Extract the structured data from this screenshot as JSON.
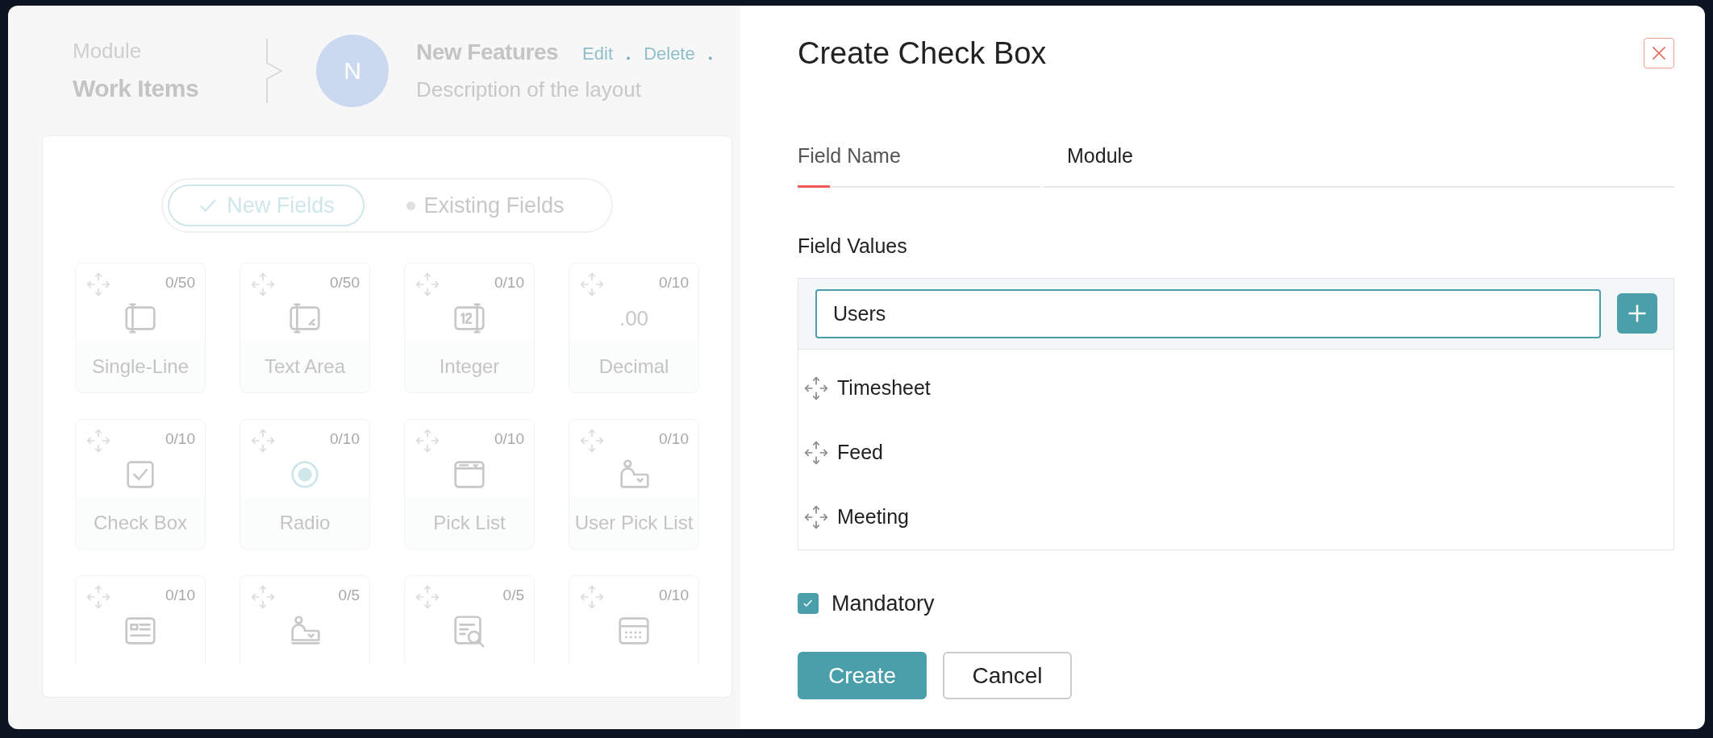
{
  "background_panel": {
    "breadcrumb": {
      "label": "Module",
      "value": "Work Items"
    },
    "layout": {
      "avatar": "N",
      "name": "New Features",
      "actions": [
        "Edit",
        "Delete"
      ],
      "separator": ".",
      "description": "Description of the layout"
    },
    "field_tabs": [
      {
        "label": "New Fields",
        "selected": true
      },
      {
        "label": "Existing Fields",
        "selected": false
      }
    ],
    "field_types": [
      {
        "kind": "single-line",
        "count": "0/50",
        "label": "Single-Line"
      },
      {
        "kind": "text-area",
        "count": "0/50",
        "label": "Text Area"
      },
      {
        "kind": "integer",
        "count": "0/10",
        "label": "Integer"
      },
      {
        "kind": "decimal",
        "count": "0/10",
        "label": "Decimal",
        "icon_text": ".00"
      },
      {
        "kind": "check-box",
        "count": "0/10",
        "label": "Check Box"
      },
      {
        "kind": "radio",
        "count": "0/10",
        "label": "Radio"
      },
      {
        "kind": "pick-list",
        "count": "0/10",
        "label": "Pick List"
      },
      {
        "kind": "user-pick-list",
        "count": "0/10",
        "label": "User Pick List"
      },
      {
        "kind": "card",
        "count": "0/10"
      },
      {
        "kind": "user-card",
        "count": "0/5"
      },
      {
        "kind": "lookup",
        "count": "0/5"
      },
      {
        "kind": "date",
        "count": "0/10"
      }
    ]
  },
  "dialog": {
    "title": "Create Check Box",
    "field_name": {
      "label": "Field Name",
      "value": "Module"
    },
    "field_values": {
      "label": "Field Values",
      "input": "Users",
      "items": [
        "Timesheet",
        "Feed",
        "Meeting"
      ]
    },
    "mandatory": {
      "label": "Mandatory",
      "checked": true
    },
    "buttons": [
      {
        "label": "Create",
        "kind": "primary"
      },
      {
        "label": "Cancel",
        "kind": "secondary"
      }
    ]
  }
}
